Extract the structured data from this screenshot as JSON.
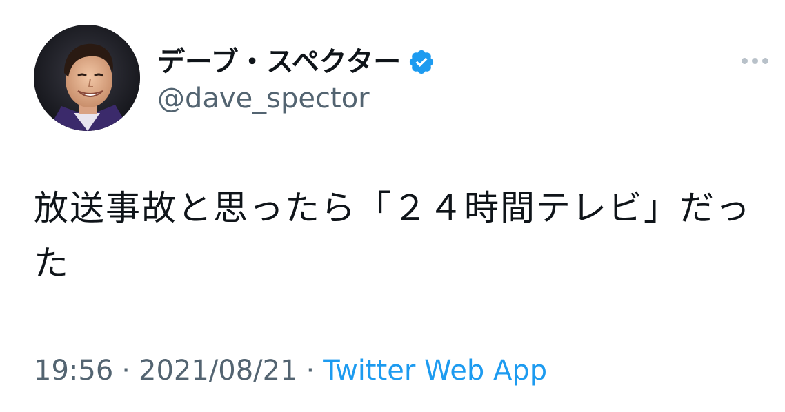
{
  "author": {
    "display_name": "デーブ・スペクター",
    "handle": "@dave_spector",
    "verified": true,
    "avatar_icon": "person-portrait-avatar"
  },
  "more_icon": "more-horizontal-icon",
  "tweet": {
    "text": "放送事故と思ったら「２４時間テレビ」だった"
  },
  "meta": {
    "time": "19:56",
    "separator": "·",
    "date": "2021/08/21",
    "source": "Twitter Web App"
  },
  "colors": {
    "text_primary": "#0f1419",
    "text_secondary": "#536471",
    "accent": "#1d9bf0",
    "verified": "#1d9bf0"
  }
}
